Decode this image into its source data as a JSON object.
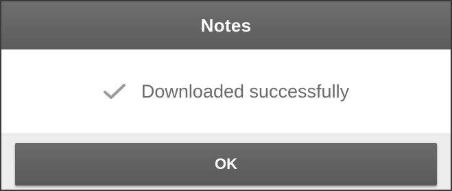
{
  "dialog": {
    "title": "Notes",
    "message": "Downloaded successfully",
    "icon": "checkmark-icon",
    "ok_label": "OK"
  },
  "colors": {
    "header_bg": "#636363",
    "button_bg": "#626262",
    "text_gray": "#6a6a6a",
    "check_gray": "#9a9a9a"
  }
}
